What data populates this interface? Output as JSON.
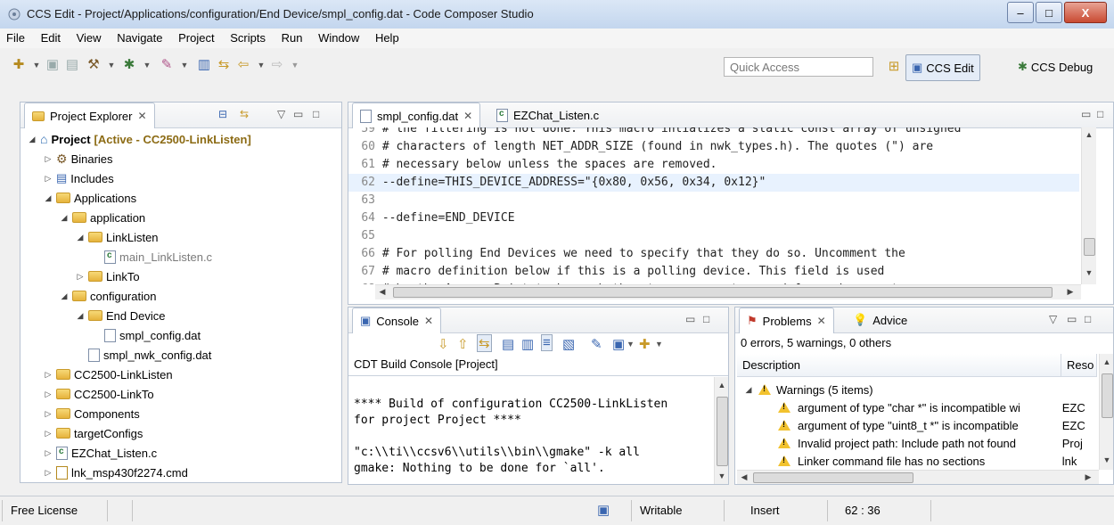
{
  "window": {
    "title": "CCS Edit - Project/Applications/configuration/End Device/smpl_config.dat - Code Composer Studio",
    "minimize": "–",
    "maximize": "□",
    "close": "X"
  },
  "menubar": [
    "File",
    "Edit",
    "View",
    "Navigate",
    "Project",
    "Scripts",
    "Run",
    "Window",
    "Help"
  ],
  "toolbar": {
    "quick_access_placeholder": "Quick Access",
    "perspectives": [
      "CCS Edit",
      "CCS Debug"
    ]
  },
  "project_explorer": {
    "tab_label": "Project Explorer",
    "tree": [
      {
        "label": "Project",
        "suffix": "[Active - CC2500-LinkListen]",
        "depth": 0,
        "icon": "project-icon",
        "state": "expanded"
      },
      {
        "label": "Binaries",
        "depth": 1,
        "icon": "binaries-icon",
        "state": "collapsed"
      },
      {
        "label": "Includes",
        "depth": 1,
        "icon": "includes-icon",
        "state": "collapsed"
      },
      {
        "label": "Applications",
        "depth": 1,
        "icon": "folder-icon",
        "state": "expanded"
      },
      {
        "label": "application",
        "depth": 2,
        "icon": "folder-icon",
        "state": "expanded"
      },
      {
        "label": "LinkListen",
        "depth": 3,
        "icon": "folder-icon",
        "state": "expanded"
      },
      {
        "label": "main_LinkListen.c",
        "depth": 4,
        "icon": "c-file-icon",
        "state": "leaf",
        "grey": true
      },
      {
        "label": "LinkTo",
        "depth": 3,
        "icon": "folder-icon",
        "state": "collapsed"
      },
      {
        "label": "configuration",
        "depth": 2,
        "icon": "folder-icon",
        "state": "expanded"
      },
      {
        "label": "End Device",
        "depth": 3,
        "icon": "folder-icon",
        "state": "expanded"
      },
      {
        "label": "smpl_config.dat",
        "depth": 4,
        "icon": "dat-file-icon",
        "state": "leaf"
      },
      {
        "label": "smpl_nwk_config.dat",
        "depth": 3,
        "icon": "dat-file-icon",
        "state": "leaf"
      },
      {
        "label": "CC2500-LinkListen",
        "depth": 1,
        "icon": "folder-icon",
        "state": "collapsed"
      },
      {
        "label": "CC2500-LinkTo",
        "depth": 1,
        "icon": "folder-icon",
        "state": "collapsed"
      },
      {
        "label": "Components",
        "depth": 1,
        "icon": "folder-icon",
        "state": "collapsed"
      },
      {
        "label": "targetConfigs",
        "depth": 1,
        "icon": "folder-icon",
        "state": "collapsed"
      },
      {
        "label": "EZChat_Listen.c",
        "depth": 1,
        "icon": "c-file-icon",
        "state": "collapsed"
      },
      {
        "label": "lnk_msp430f2274.cmd",
        "depth": 1,
        "icon": "cmd-file-icon",
        "state": "collapsed"
      }
    ]
  },
  "editor": {
    "tabs": [
      "smpl_config.dat",
      "EZChat_Listen.c"
    ],
    "lines": [
      {
        "n": "59",
        "text": "# the filtering is not done. This macro intializes a static const array of unsigned"
      },
      {
        "n": "60",
        "text": "# characters of length NET_ADDR_SIZE (found in nwk_types.h). The quotes (\") are"
      },
      {
        "n": "61",
        "text": "# necessary below unless the spaces are removed."
      },
      {
        "n": "62",
        "text": "--define=THIS_DEVICE_ADDRESS=\"{0x80, 0x56, 0x34, 0x12}\""
      },
      {
        "n": "63",
        "text": ""
      },
      {
        "n": "64",
        "text": "--define=END_DEVICE"
      },
      {
        "n": "65",
        "text": ""
      },
      {
        "n": "66",
        "text": "# For polling End Devices we need to specify that they do so. Uncomment the"
      },
      {
        "n": "67",
        "text": "# macro definition below if this is a polling device. This field is used"
      },
      {
        "n": "68",
        "text": "# by the Access Point to know whether to reserve store-and-forward support"
      }
    ]
  },
  "console": {
    "tab_label": "Console",
    "header": "CDT Build Console [Project]",
    "lines": [
      "",
      "**** Build of configuration CC2500-LinkListen",
      "for project Project ****",
      "",
      "\"c:\\\\ti\\\\ccsv6\\\\utils\\\\bin\\\\gmake\" -k all",
      "gmake: Nothing to be done for `all'."
    ]
  },
  "problems": {
    "tabs": [
      "Problems",
      "Advice"
    ],
    "summary": "0 errors, 5 warnings, 0 others",
    "columns": [
      "Description",
      "Reso"
    ],
    "group": "Warnings (5 items)",
    "rows": [
      {
        "desc": "argument of type \"char *\" is incompatible wi",
        "res": "EZC"
      },
      {
        "desc": "argument of type \"uint8_t *\" is incompatible",
        "res": "EZC"
      },
      {
        "desc": "Invalid project path: Include path not found",
        "res": "Proj"
      },
      {
        "desc": "Linker command file has no sections",
        "res": "lnk"
      }
    ]
  },
  "statusbar": {
    "license": "Free License",
    "mode": "Writable",
    "insert": "Insert",
    "position": "62 : 36"
  }
}
